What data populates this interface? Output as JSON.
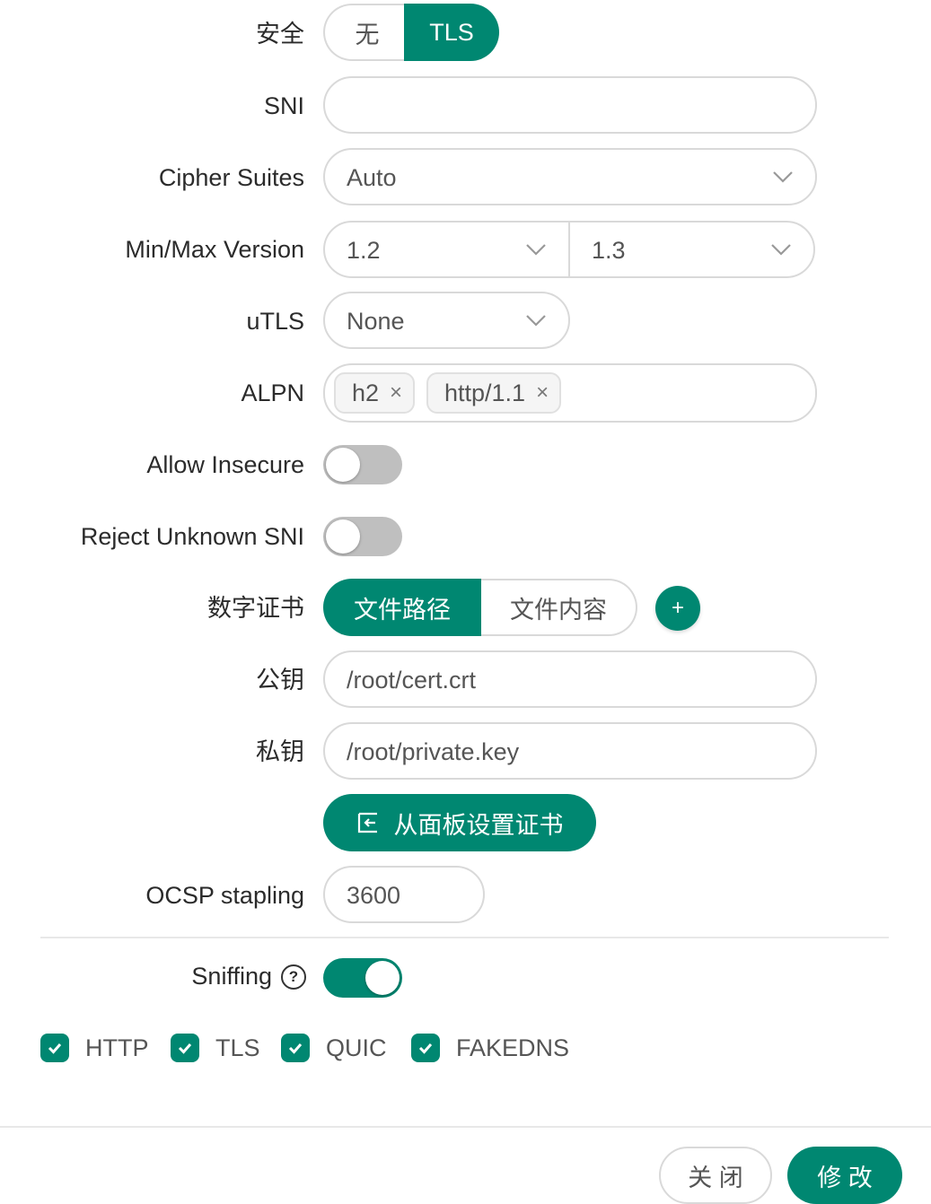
{
  "security": {
    "label": "安全",
    "options": [
      "无",
      "TLS"
    ],
    "selected": "TLS"
  },
  "sni": {
    "label": "SNI",
    "value": ""
  },
  "cipher_suites": {
    "label": "Cipher Suites",
    "value": "Auto"
  },
  "version": {
    "label": "Min/Max Version",
    "min": "1.2",
    "max": "1.3"
  },
  "utls": {
    "label": "uTLS",
    "value": "None"
  },
  "alpn": {
    "label": "ALPN",
    "tags": [
      "h2",
      "http/1.1"
    ],
    "remove_glyph": "×"
  },
  "allow_insecure": {
    "label": "Allow Insecure",
    "on": false
  },
  "reject_unknown_sni": {
    "label": "Reject Unknown SNI",
    "on": false
  },
  "certificate": {
    "label": "数字证书",
    "options": [
      "文件路径",
      "文件内容"
    ],
    "selected": "文件路径",
    "add_glyph": "+"
  },
  "public_key": {
    "label": "公钥",
    "value": "/root/cert.crt"
  },
  "private_key": {
    "label": "私钥",
    "value": "/root/private.key"
  },
  "panel_cert_button": {
    "label": "从面板设置证书"
  },
  "ocsp": {
    "label": "OCSP stapling",
    "value": "3600"
  },
  "sniffing": {
    "label": "Sniffing",
    "on": true,
    "help_glyph": "?"
  },
  "sniff_protocols": [
    {
      "label": "HTTP",
      "checked": true
    },
    {
      "label": "TLS",
      "checked": true
    },
    {
      "label": "QUIC",
      "checked": true
    },
    {
      "label": "FAKEDNS",
      "checked": true
    }
  ],
  "footer": {
    "close_label": "关 闭",
    "save_label": "修 改"
  },
  "colors": {
    "accent": "#008771",
    "border": "#d9d9d9",
    "switch_off": "#bfbfbf"
  }
}
